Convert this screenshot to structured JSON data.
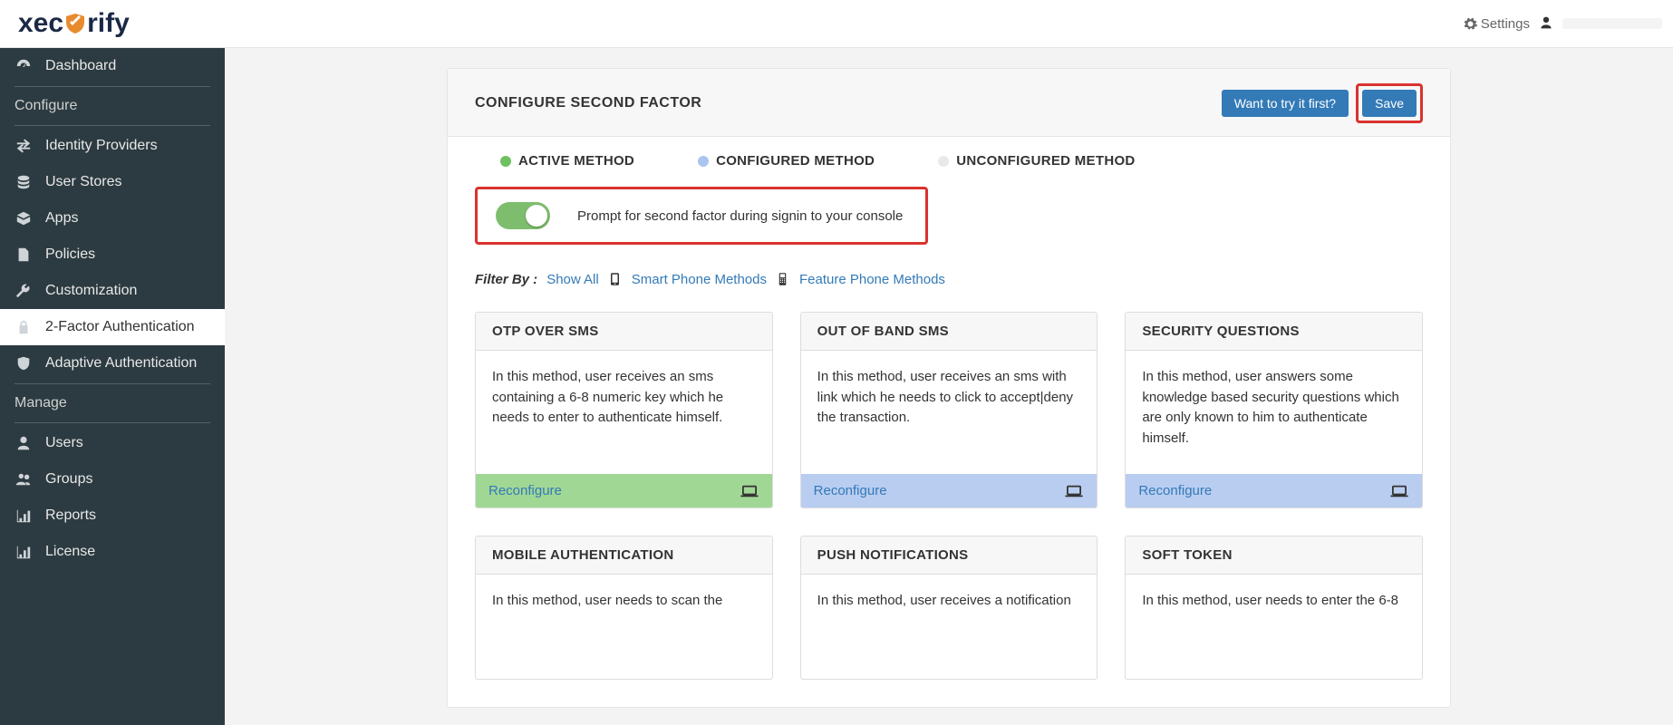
{
  "header": {
    "logo_part1": "xec",
    "logo_part2": "rify",
    "settings_label": "Settings"
  },
  "sidebar": {
    "items": [
      {
        "label": "Dashboard",
        "icon": "dashboard"
      },
      {
        "label": "Configure",
        "section": true
      },
      {
        "label": "Identity Providers",
        "icon": "exchange"
      },
      {
        "label": "User Stores",
        "icon": "database"
      },
      {
        "label": "Apps",
        "icon": "cube"
      },
      {
        "label": "Policies",
        "icon": "file"
      },
      {
        "label": "Customization",
        "icon": "wrench"
      },
      {
        "label": "2-Factor Authentication",
        "icon": "lock",
        "active": true
      },
      {
        "label": "Adaptive Authentication",
        "icon": "shield"
      },
      {
        "label": "Manage",
        "section": true
      },
      {
        "label": "Users",
        "icon": "user"
      },
      {
        "label": "Groups",
        "icon": "users"
      },
      {
        "label": "Reports",
        "icon": "chart"
      },
      {
        "label": "License",
        "icon": "chart"
      }
    ]
  },
  "panel": {
    "title": "CONFIGURE SECOND FACTOR",
    "try_label": "Want to try it first?",
    "save_label": "Save"
  },
  "legend": {
    "active": "ACTIVE METHOD",
    "configured": "CONFIGURED METHOD",
    "unconfigured": "UNCONFIGURED METHOD"
  },
  "prompt": {
    "text": "Prompt for second factor during signin to your console"
  },
  "filter": {
    "label": "Filter By :",
    "show_all": "Show All",
    "smart": "Smart Phone Methods",
    "feature": "Feature Phone Methods"
  },
  "methods": [
    {
      "title": "OTP OVER SMS",
      "desc": "In this method, user receives an sms containing a 6-8 numeric key which he needs to enter to authenticate himself.",
      "action": "Reconfigure",
      "status": "active"
    },
    {
      "title": "OUT OF BAND SMS",
      "desc": "In this method, user receives an sms with link which he needs to click to accept|deny the transaction.",
      "action": "Reconfigure",
      "status": "configured"
    },
    {
      "title": "SECURITY QUESTIONS",
      "desc": "In this method, user answers some knowledge based security questions which are only known to him to authenticate himself.",
      "action": "Reconfigure",
      "status": "configured"
    },
    {
      "title": "MOBILE AUTHENTICATION",
      "desc": "In this method, user needs to scan the",
      "action": "",
      "status": "unconfigured"
    },
    {
      "title": "PUSH NOTIFICATIONS",
      "desc": "In this method, user receives a notification",
      "action": "",
      "status": "unconfigured"
    },
    {
      "title": "SOFT TOKEN",
      "desc": "In this method, user needs to enter the 6-8",
      "action": "",
      "status": "unconfigured"
    }
  ]
}
